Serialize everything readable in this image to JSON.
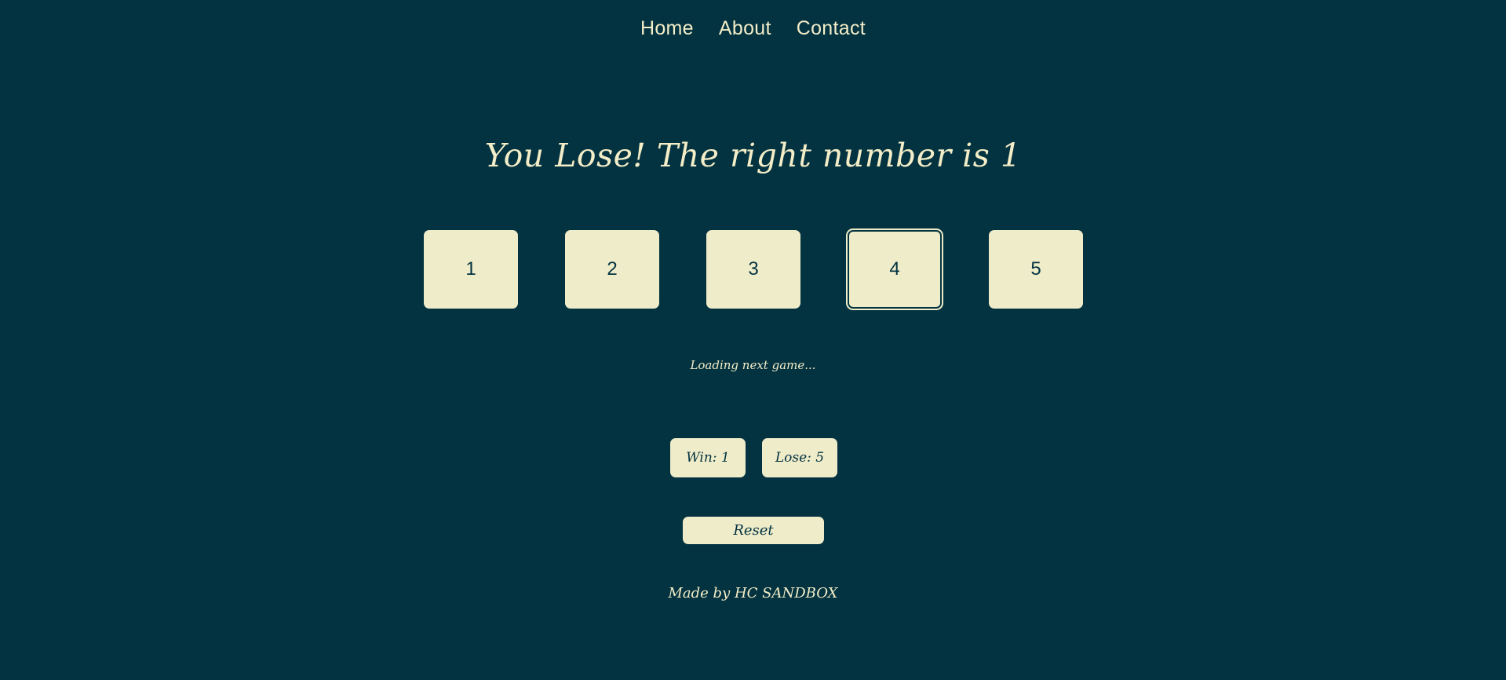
{
  "nav": {
    "items": [
      {
        "label": "Home"
      },
      {
        "label": "About"
      },
      {
        "label": "Contact"
      }
    ]
  },
  "game": {
    "result_text": "You Lose! The right number is 1",
    "choices": [
      "1",
      "2",
      "3",
      "4",
      "5"
    ],
    "selected_choice": "4",
    "status_text": "Loading next game...",
    "win_label": "Win: 1",
    "lose_label": "Lose: 5",
    "reset_label": "Reset"
  },
  "footer": {
    "text": "Made by HC SANDBOX"
  },
  "colors": {
    "background": "#033340",
    "card": "#efecca",
    "text_light": "#f3edc8",
    "text_dark": "#033340"
  }
}
